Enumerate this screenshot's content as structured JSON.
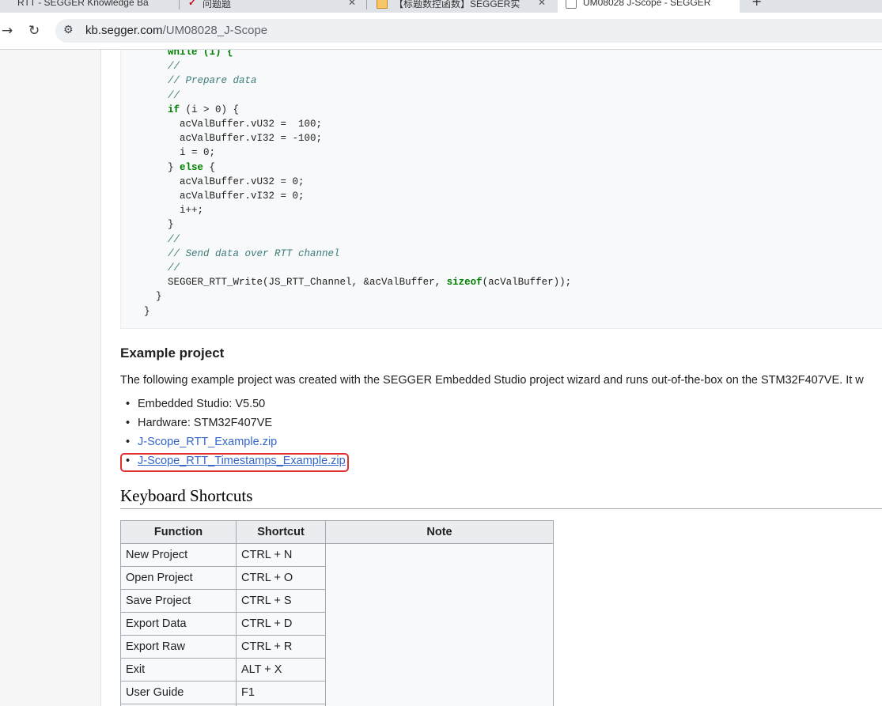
{
  "browser": {
    "tabs": [
      {
        "title": "RTT - SEGGER Knowledge Ba"
      },
      {
        "title": "问题题"
      },
      {
        "title": "【标题数控函数】SEGGER实"
      },
      {
        "title": "UM08028 J-Scope - SEGGER"
      }
    ],
    "url_domain": "kb.segger.com",
    "url_path": "/UM08028_J-Scope"
  },
  "code": {
    "l1": "while (1) {",
    "l2": "//",
    "l3": "// Prepare data",
    "l4": "//",
    "l5_kw": "if",
    "l5": " (i > 0) {",
    "l6": "acValBuffer.vU32 =  100;",
    "l7": "acValBuffer.vI32 = -100;",
    "l8": "i = 0;",
    "l9a": "} ",
    "l9_kw": "else",
    "l9b": " {",
    "l10": "acValBuffer.vU32 = 0;",
    "l11": "acValBuffer.vI32 = 0;",
    "l12": "i++;",
    "l13": "}",
    "l14": "//",
    "l15": "// Send data over RTT channel",
    "l16": "//",
    "l17a": "SEGGER_RTT_Write(JS_RTT_Channel, &acValBuffer, ",
    "l17_kw": "sizeof",
    "l17b": "(acValBuffer));",
    "l18": "}",
    "l19": "}"
  },
  "example": {
    "heading": "Example project",
    "text": "The following example project was created with the SEGGER Embedded Studio project wizard and runs out-of-the-box on the STM32F407VE. It w",
    "items": [
      "Embedded Studio: V5.50",
      "Hardware: STM32F407VE",
      "J-Scope_RTT_Example.zip",
      "J-Scope_RTT_Timestamps_Example.zip"
    ]
  },
  "shortcuts": {
    "heading": "Keyboard Shortcuts",
    "headers": [
      "Function",
      "Shortcut",
      "Note"
    ],
    "rows": [
      [
        "New Project",
        "CTRL + N"
      ],
      [
        "Open Project",
        "CTRL + O"
      ],
      [
        "Save Project",
        "CTRL + S"
      ],
      [
        "Export Data",
        "CTRL + D"
      ],
      [
        "Export Raw",
        "CTRL + R"
      ],
      [
        "Exit",
        "ALT + X"
      ],
      [
        "User Guide",
        "F1"
      ]
    ]
  },
  "colors": {
    "link": "#3366cc",
    "highlight": "#e03131",
    "keyword": "#008000",
    "comment": "#3d7b7b"
  }
}
